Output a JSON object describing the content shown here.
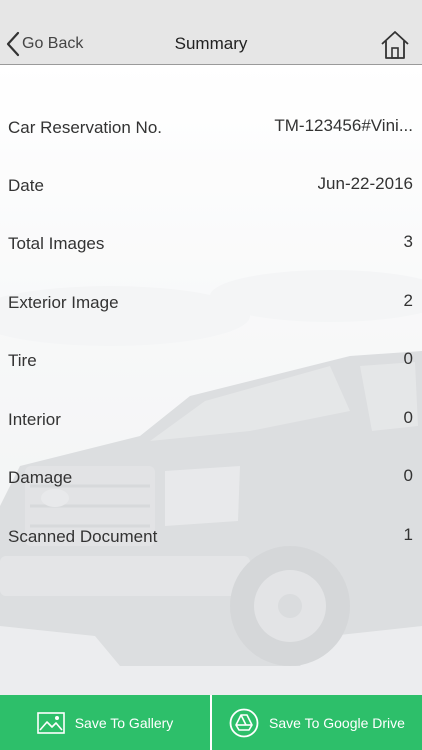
{
  "navbar": {
    "back_label": "Go Back",
    "title": "Summary",
    "back_icon": "chevron-left-icon",
    "home_icon": "home-icon"
  },
  "summary": {
    "rows": [
      {
        "label": "Car Reservation No.",
        "value": "TM-123456#Vini..."
      },
      {
        "label": "Date",
        "value": "Jun-22-2016"
      },
      {
        "label": "Total Images",
        "value": "3"
      },
      {
        "label": "Exterior Image",
        "value": "2"
      },
      {
        "label": "Tire",
        "value": "0"
      },
      {
        "label": "Interior",
        "value": "0"
      },
      {
        "label": "Damage",
        "value": "0"
      },
      {
        "label": "Scanned Document",
        "value": "1"
      }
    ]
  },
  "actions": {
    "save_gallery_label": "Save To Gallery",
    "save_gallery_icon": "image-icon",
    "save_drive_label": "Save To Google Drive",
    "save_drive_icon": "google-drive-icon"
  },
  "colors": {
    "accent": "#2dbf6a",
    "navbar_bg": "#e6e6e6"
  }
}
